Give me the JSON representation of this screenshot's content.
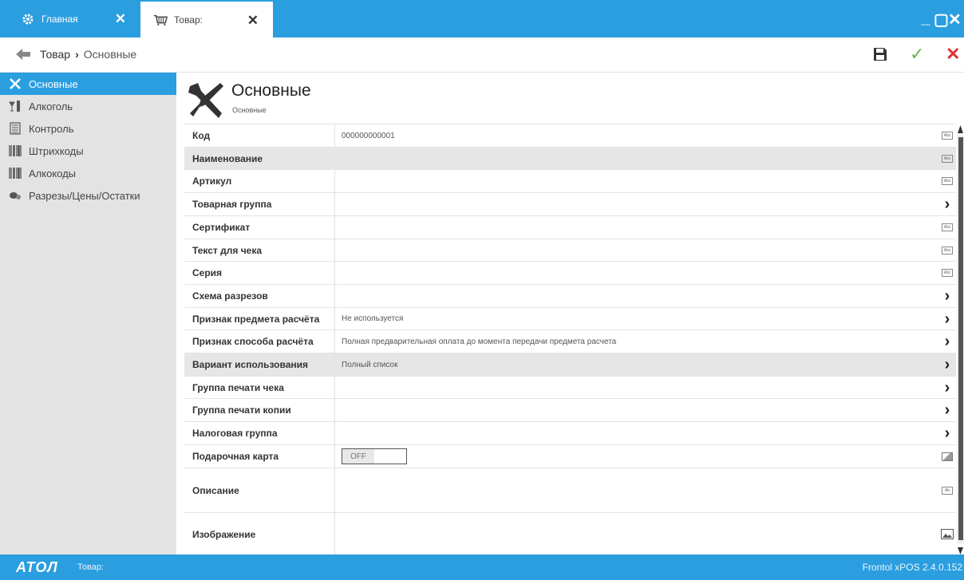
{
  "tabs": [
    {
      "label": "Главная",
      "icon": "gear-icon"
    },
    {
      "label": "Товар:",
      "icon": "basket-icon"
    }
  ],
  "toolbar": {
    "breadcrumb_root": "Товар",
    "breadcrumb_separator": "›",
    "breadcrumb_current": "Основные"
  },
  "sidebar": {
    "items": [
      {
        "label": "Основные",
        "icon": "tools-icon",
        "active": true
      },
      {
        "label": "Алкоголь",
        "icon": "wine-icon"
      },
      {
        "label": "Контроль",
        "icon": "checklist-icon"
      },
      {
        "label": "Штрихкоды",
        "icon": "barcode-icon"
      },
      {
        "label": "Алкокоды",
        "icon": "barcode-icon"
      },
      {
        "label": "Разрезы/Цены/Остатки",
        "icon": "coins-icon"
      }
    ]
  },
  "header": {
    "title": "Основные",
    "subtitle": "Основные"
  },
  "fields": [
    {
      "label": "Код",
      "value": "000000000001",
      "action": "text-edit-icon"
    },
    {
      "label": "Наименование",
      "value": "",
      "action": "text-edit-icon"
    },
    {
      "label": "Артикул",
      "value": "",
      "action": "text-edit-icon"
    },
    {
      "label": "Товарная группа",
      "value": "",
      "action": "chevron-right-icon"
    },
    {
      "label": "Сертификат",
      "value": "",
      "action": "text-edit-icon"
    },
    {
      "label": "Текст для чека",
      "value": "",
      "action": "text-edit-icon"
    },
    {
      "label": "Серия",
      "value": "",
      "action": "text-edit-icon"
    },
    {
      "label": "Схема разрезов",
      "value": "",
      "action": "chevron-right-icon"
    },
    {
      "label": "Признак предмета расчёта",
      "value": "Не используется",
      "action": "chevron-right-icon"
    },
    {
      "label": "Признак способа расчёта",
      "value": "Полная предварительная оплата до момента передачи предмета расчета",
      "action": "chevron-right-icon"
    },
    {
      "label": "Вариант использования",
      "value": "Полный список",
      "action": "chevron-right-icon"
    },
    {
      "label": "Группа печати чека",
      "value": "",
      "action": "chevron-right-icon"
    },
    {
      "label": "Группа печати копии",
      "value": "",
      "action": "chevron-right-icon"
    },
    {
      "label": "Налоговая группа",
      "value": "",
      "action": "chevron-right-icon"
    },
    {
      "label": "Подарочная карта",
      "toggle": "OFF",
      "action": "toggle-icon"
    },
    {
      "label": "Описание",
      "value": "",
      "action": "multiline-edit-icon"
    },
    {
      "label": "Изображение",
      "value": "",
      "action": "image-icon"
    }
  ],
  "statusbar": {
    "logo": "ATOЛ",
    "text": "Товар:",
    "version": "Frontol xPOS 2.4.0.152"
  },
  "colors": {
    "accent": "#2b9ee0",
    "sidebar_bg": "#e3e3e3",
    "ok": "#6cb24a",
    "cancel": "#e03131"
  }
}
